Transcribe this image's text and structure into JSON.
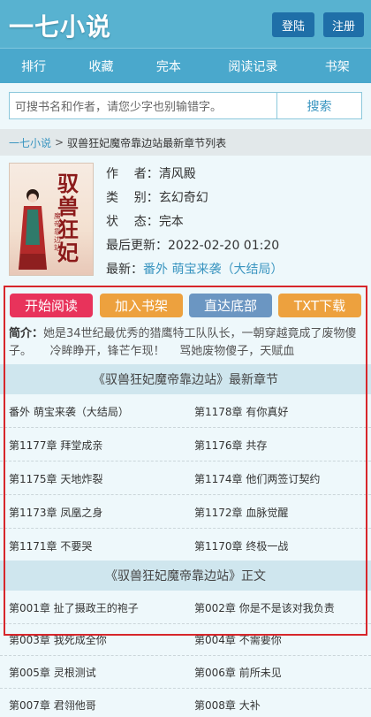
{
  "header": {
    "logo": "一七小说",
    "login": "登陆",
    "register": "注册"
  },
  "nav": [
    "排行",
    "收藏",
    "完本",
    "阅读记录",
    "书架"
  ],
  "search": {
    "placeholder": "可搜书名和作者，请您少字也别输错字。",
    "button": "搜索"
  },
  "breadcrumb": {
    "home": "一七小说",
    "sep": ">",
    "current": "驭兽狂妃魔帝靠边站最新章节列表"
  },
  "book": {
    "cover_title": "驭兽狂妃",
    "cover_sub": "魔帝靠边站",
    "author_label": "作    者：",
    "author": "清风殿",
    "category_label": "类    别：",
    "category": "玄幻奇幻",
    "status_label": "状    态：",
    "status": "完本",
    "updated_label": "最后更新：",
    "updated": "2022-02-20 01:20",
    "latest_label": "最新：",
    "latest": "番外 萌宝来袭（大结局）"
  },
  "actions": {
    "read": "开始阅读",
    "shelf": "加入书架",
    "bottom": "直达底部",
    "txt": "TXT下载"
  },
  "intro": {
    "label": "简介：",
    "text": "她是34世纪最优秀的猎鹰特工队队长，一朝穿越竟成了废物傻子。     冷眸睁开，锋芒乍现！    骂她废物傻子，天赋血"
  },
  "latest_section": {
    "title": "《驭兽狂妃魔帝靠边站》最新章节",
    "rows": [
      [
        "番外 萌宝来袭（大结局）",
        "第1178章 有你真好"
      ],
      [
        "第1177章 拜堂成亲",
        "第1176章 共存"
      ],
      [
        "第1175章 天地炸裂",
        "第1174章 他们两签订契约"
      ],
      [
        "第1173章 凤凰之身",
        "第1172章 血脉觉醒"
      ],
      [
        "第1171章 不要哭",
        "第1170章 终极一战"
      ]
    ]
  },
  "main_section": {
    "title": "《驭兽狂妃魔帝靠边站》正文",
    "rows": [
      [
        "第001章 扯了摄政王的袍子",
        "第002章 你是不是该对我负责"
      ],
      [
        "第003章 我死成全你",
        "第004章 不需要你"
      ],
      [
        "第005章 灵根测试",
        "第006章 前所未见"
      ],
      [
        "第007章 君翎他哥",
        "第008章 大补"
      ]
    ]
  },
  "colors": {
    "header": "#58b2d0",
    "nav": "#4aa8cc",
    "frame": "#d7262b",
    "read": "#e8335b",
    "orange": "#eda13e",
    "blue": "#6b96c2"
  }
}
